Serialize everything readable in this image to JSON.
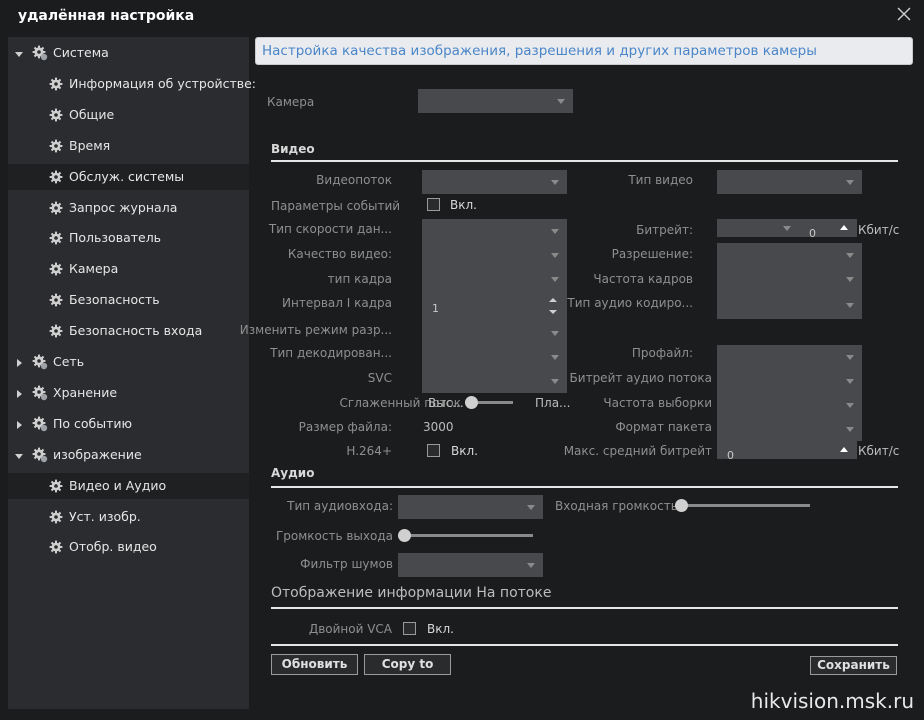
{
  "window": {
    "title": "удалённая настройка"
  },
  "sidebar": {
    "items": [
      {
        "label": "Система",
        "level": 0,
        "expanded": true
      },
      {
        "label": "Информация об устройстве:",
        "level": 1
      },
      {
        "label": "Общие",
        "level": 1
      },
      {
        "label": "Время",
        "level": 1
      },
      {
        "label": "Обслуж. системы",
        "level": 1,
        "selected": true
      },
      {
        "label": "Запрос журнала",
        "level": 1
      },
      {
        "label": "Пользователь",
        "level": 1
      },
      {
        "label": "Камера",
        "level": 1
      },
      {
        "label": "Безопасность",
        "level": 1
      },
      {
        "label": "Безопасность входа",
        "level": 1
      },
      {
        "label": "Сеть",
        "level": 0,
        "expanded": false
      },
      {
        "label": "Хранение",
        "level": 0,
        "expanded": false
      },
      {
        "label": "По событию",
        "level": 0,
        "expanded": false
      },
      {
        "label": "изображение",
        "level": 0,
        "expanded": true
      },
      {
        "label": "Видео и Аудио",
        "level": 1,
        "selected": true
      },
      {
        "label": "Уст. изобр.",
        "level": 1
      },
      {
        "label": "Отобр. видео",
        "level": 1
      }
    ]
  },
  "main": {
    "header": "Настройка качества изображения, разрешения и других параметров камеры",
    "camera_label": "Камера",
    "video": {
      "section": "Видео",
      "stream": "Видеопоток",
      "video_type": "Тип видео",
      "event_params": "Параметры событий",
      "on": "Вкл.",
      "rate_type": "Тип скорости дан...",
      "bitrate": "Битрейт:",
      "bitrate_value": "0",
      "kbps": "Кбит/с",
      "quality": "Качество видео:",
      "resolution": "Разрешение:",
      "frame_type": "тип кадра",
      "frame_rate": "Частота кадров",
      "iframe_interval": "Интервал I кадра",
      "iframe_value": "1",
      "audio_codec": "Тип аудио кодиро...",
      "change_mode": "Изменить режим разр...",
      "decode_type": "Тип декодирован...",
      "profile": "Профайл:",
      "svc": "SVC",
      "audio_bitrate": "Битрейт аудио потока",
      "smooth_stream": "Сглаженный поток",
      "smooth_low": "Выс...",
      "smooth_high": "Пла...",
      "sampling": "Частота выборки",
      "file_size": "Размер файла:",
      "file_size_value": "3000",
      "packet_format": "Формат пакета",
      "h264plus": "H.264+",
      "max_avg_bitrate": "Макс. средний битрейт",
      "max_avg_value": "0"
    },
    "audio": {
      "section": "Аудио",
      "input_type": "Тип аудиовхода:",
      "input_volume": "Входная громкость",
      "output_volume": "Громкость выхода",
      "noise_filter": "Фильтр шумов"
    },
    "osd": {
      "section": "Отображение информации На потоке",
      "dual_vca": "Двойной VCA"
    },
    "buttons": {
      "refresh": "Обновить",
      "copy": "Copy to",
      "save": "Сохранить"
    }
  },
  "watermark": "hikvision.msk.ru"
}
